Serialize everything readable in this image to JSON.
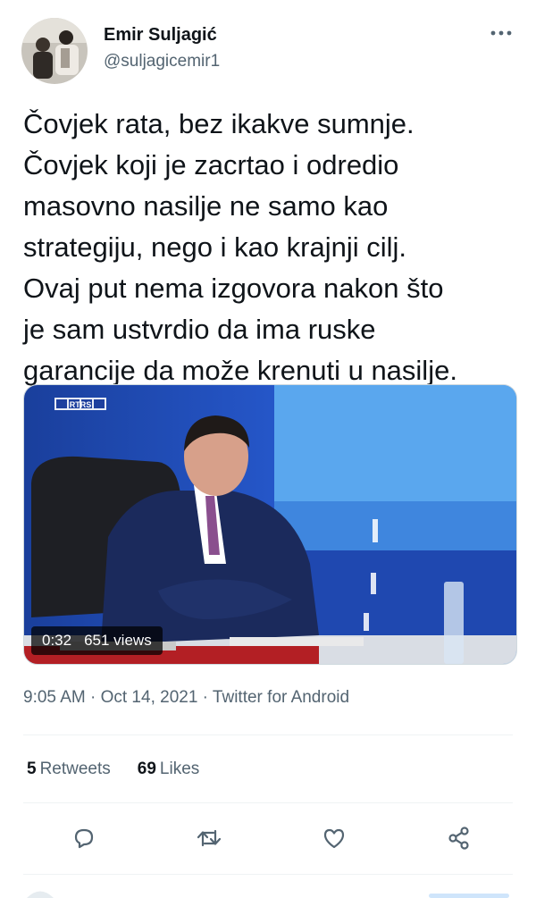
{
  "author": {
    "name": "Emir Suljagić",
    "handle": "@suljagicemir1",
    "avatar_icon": "profile-photo"
  },
  "tweet": {
    "text_lines": [
      "Čovjek rata, bez ikakve sumnje.",
      "Čovjek koji je zacrtao i odredio",
      "masovno nasilje ne samo kao",
      "strategiju, nego i kao krajnji cilj.",
      "Ovaj put nema izgovora nakon što",
      "je sam ustvrdio da ima ruske",
      "garancije da može krenuti u nasilje."
    ],
    "video": {
      "duration": "0:32",
      "views": "651 views",
      "channel_logo": "RTRS"
    },
    "timestamp": "9:05 AM · Oct 14, 2021 · Twitter for Android"
  },
  "stats": {
    "retweets_count": "5",
    "retweets_label": "Retweets",
    "likes_count": "69",
    "likes_label": "Likes"
  },
  "actions": [
    "reply-icon",
    "retweet-icon",
    "like-icon",
    "share-icon"
  ],
  "colors": {
    "text": "#0f1419",
    "secondary": "#536471",
    "divider": "#eff3f4"
  }
}
